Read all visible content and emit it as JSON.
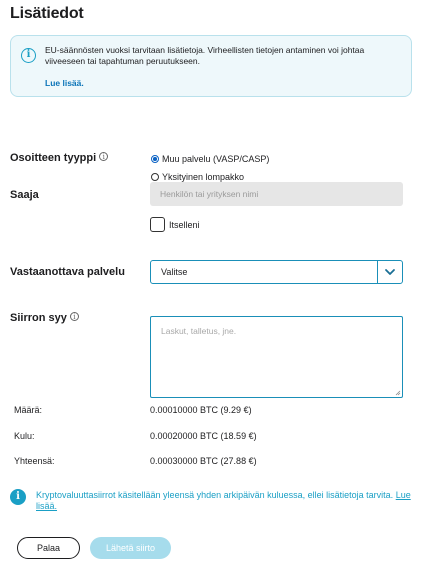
{
  "header": {
    "title": "Lisätiedot"
  },
  "notice": {
    "text": "EU-säännösten vuoksi tarvitaan lisätietoja. Virheellisten tietojen antaminen voi johtaa viiveeseen tai tapahtuman peruutukseen.",
    "link": "Lue lisää."
  },
  "address_type": {
    "label": "Osoitteen tyyppi",
    "options": [
      {
        "label": "Muu palvelu (VASP/CASP)",
        "selected": true
      },
      {
        "label": "Yksityinen lompakko",
        "selected": false
      }
    ]
  },
  "recipient": {
    "label": "Saaja",
    "placeholder": "Henkilön tai yrityksen nimi",
    "self_label": "Itselleni"
  },
  "receiving_service": {
    "label": "Vastaanottava palvelu",
    "selected": "Valitse"
  },
  "transfer_reason": {
    "label": "Siirron syy",
    "placeholder": "Laskut, talletus, jne."
  },
  "summary": [
    {
      "label": "Määrä:",
      "value": "0.00010000 BTC (9.29 €)"
    },
    {
      "label": "Kulu:",
      "value": "0.00020000 BTC (18.59 €)"
    },
    {
      "label": "Yhteensä:",
      "value": "0.00030000 BTC (27.88 €)"
    }
  ],
  "footer_note": {
    "text": "Kryptovaluuttasiirrot käsitellään yleensä yhden arkipäivän kuluessa, ellei lisätietoja tarvita.",
    "link": "Lue lisää."
  },
  "actions": {
    "back": "Palaa",
    "send": "Lähetä siirto"
  },
  "colors": {
    "accent": "#1a9fc5",
    "link": "#0b74b8",
    "send_disabled": "#a6dcec"
  }
}
